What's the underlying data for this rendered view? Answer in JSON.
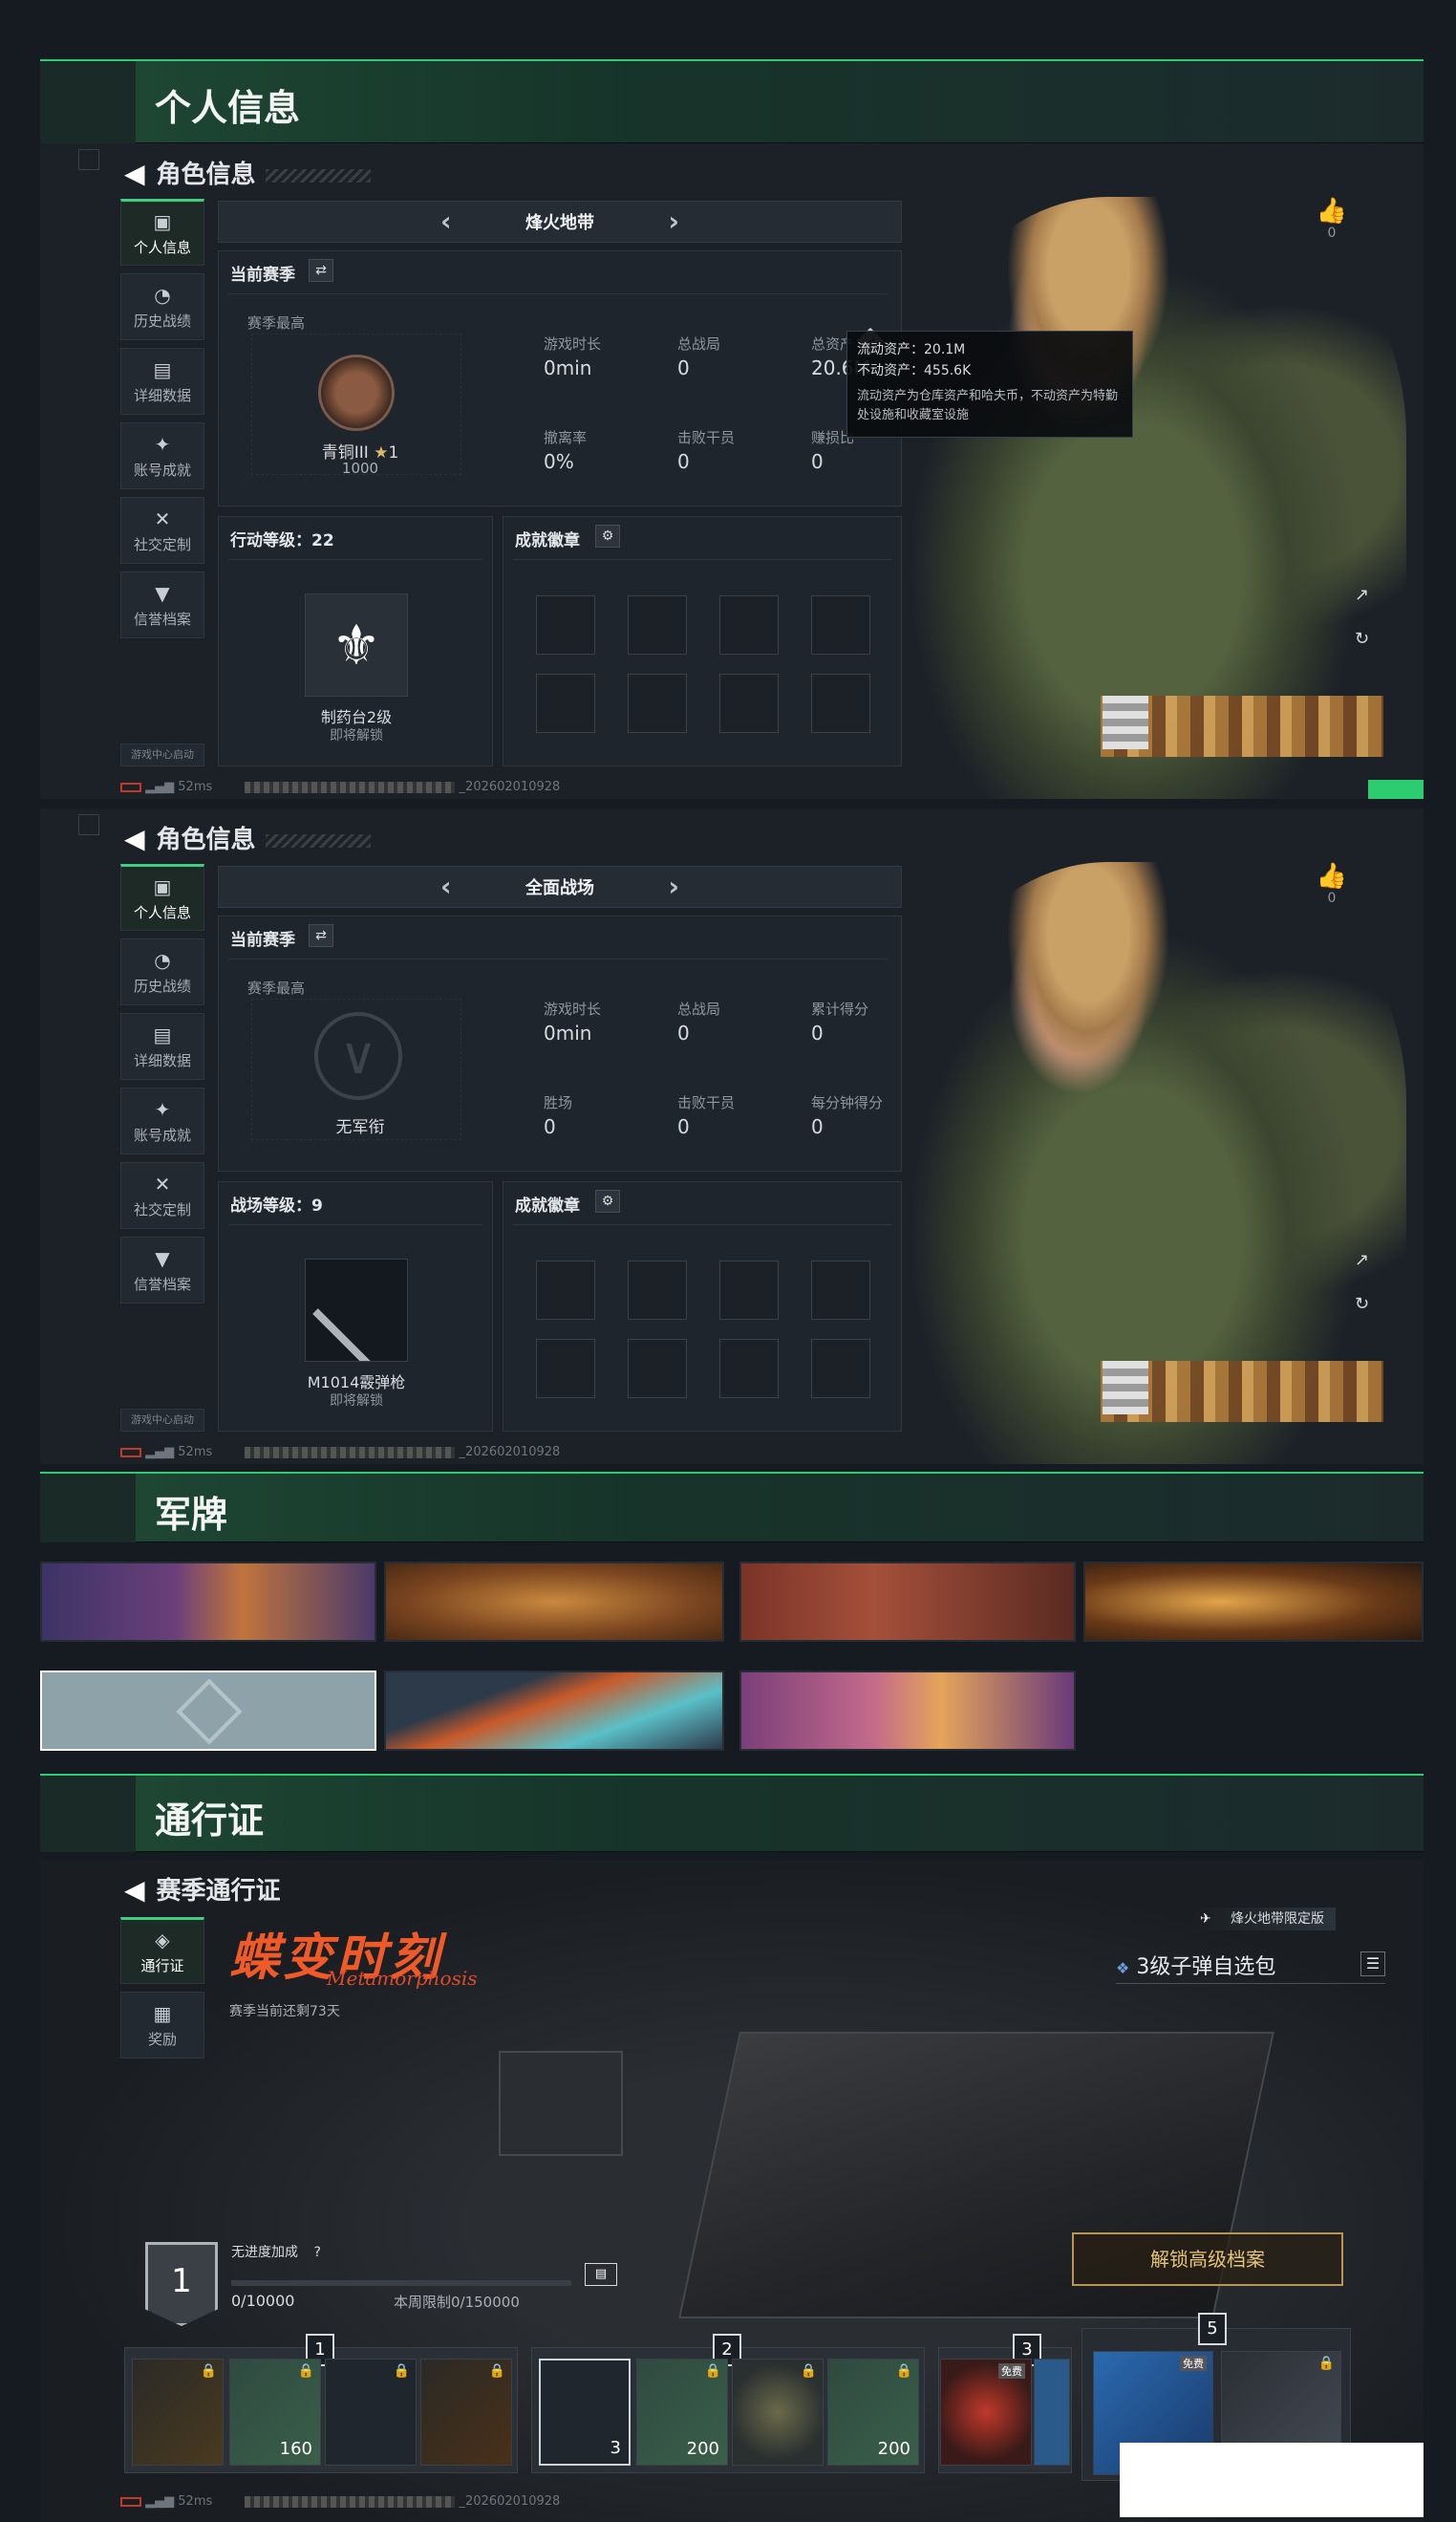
{
  "sections": {
    "personal": "个人信息",
    "military_cards": "军牌",
    "pass": "通行证"
  },
  "role_panel_title": "角色信息",
  "side_items": [
    {
      "icon": "bar-chart-icon",
      "label": "个人信息"
    },
    {
      "icon": "history-icon",
      "label": "历史战绩"
    },
    {
      "icon": "data-icon",
      "label": "详细数据"
    },
    {
      "icon": "medal-icon",
      "label": "账号成就"
    },
    {
      "icon": "tools-icon",
      "label": "社交定制"
    },
    {
      "icon": "shield-icon",
      "label": "信誉档案"
    }
  ],
  "game_center": "游戏中心启动",
  "like_count": "0",
  "ping": "52ms",
  "build_id": "_202602010928",
  "panel1": {
    "mode": "烽火地带",
    "season_label": "当前赛季",
    "season_best": "赛季最高",
    "rank_name": "青铜III",
    "rank_stars": "1",
    "rank_points": "1000",
    "stats": [
      {
        "label": "游戏时长",
        "value": "0min"
      },
      {
        "label": "总战局",
        "value": "0"
      },
      {
        "label": "总资产",
        "value": "20.6M"
      },
      {
        "label": "撤离率",
        "value": "0%"
      },
      {
        "label": "击败干员",
        "value": "0"
      },
      {
        "label": "赚损比",
        "value": "0"
      }
    ],
    "tooltip": {
      "liquid": "流动资产：20.1M",
      "fixed": "不动资产：455.6K",
      "desc": "流动资产为仓库资产和哈夫币，不动资产为特勤处设施和收藏室设施"
    },
    "level_label": "行动等级：22",
    "unlock_name": "制药台2级",
    "unlock_note": "即将解锁",
    "badges_label": "成就徽章"
  },
  "panel2": {
    "mode": "全面战场",
    "season_label": "当前赛季",
    "season_best": "赛季最高",
    "rank_name": "无军衔",
    "stats": [
      {
        "label": "游戏时长",
        "value": "0min"
      },
      {
        "label": "总战局",
        "value": "0"
      },
      {
        "label": "累计得分",
        "value": "0"
      },
      {
        "label": "胜场",
        "value": "0"
      },
      {
        "label": "击败干员",
        "value": "0"
      },
      {
        "label": "每分钟得分",
        "value": "0"
      }
    ],
    "level_label": "战场等级：9",
    "unlock_name": "M1014霰弹枪",
    "unlock_note": "即将解锁",
    "badges_label": "成就徽章"
  },
  "pass": {
    "header": "赛季通行证",
    "tab_pass": "通行证",
    "tab_reward": "奖励",
    "logo": "蝶变时刻",
    "logo_sub": "Metamorphosis",
    "days_left": "赛季当前还剩73天",
    "edition": "烽火地带限定版",
    "item_name": "3级子弹自选包",
    "level": "1",
    "no_boost": "无进度加成",
    "help": "?",
    "progress": "0/10000",
    "weekly_limit": "本周限制0/150000",
    "unlock_button": "解锁高级档案",
    "progress_fraction": 0,
    "groups": [
      "1",
      "2",
      "3",
      "5"
    ],
    "free_tag": "免费",
    "rewards": [
      {
        "count": ""
      },
      {
        "count": "160"
      },
      {
        "count": ""
      },
      {
        "count": ""
      },
      {
        "count": "3"
      },
      {
        "count": "200"
      },
      {
        "count": ""
      },
      {
        "count": "200"
      },
      {
        "count": ""
      },
      {
        "count": ""
      },
      {
        "count": ""
      },
      {
        "count": ""
      }
    ]
  },
  "colors": {
    "accent": "#3fd07f",
    "gold": "#d9b96a",
    "logo": "#f05a28"
  }
}
